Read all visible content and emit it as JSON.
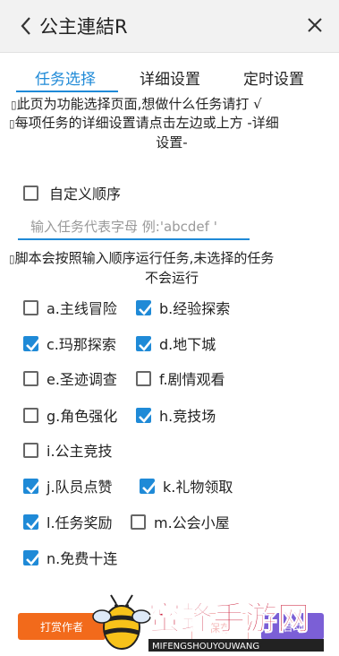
{
  "header": {
    "title": "公主連結R"
  },
  "tabs": [
    {
      "label": "任务选择",
      "active": true
    },
    {
      "label": "详细设置",
      "active": false
    },
    {
      "label": "定时设置",
      "active": false
    }
  ],
  "info": {
    "glyph": "▯",
    "line1": "此页为功能选择页面,想做什么任务请打 √",
    "line2a": "每项任务的详细设置请点击左边或上方 -详细",
    "line2b": "设置-",
    "line3a": "脚本会按照输入顺序运行任务,未选择的任务",
    "line3b": "不会运行"
  },
  "custom_order": {
    "label": "自定义顺序",
    "checked": false
  },
  "order_input": {
    "placeholder": "输入任务代表字母 例:'abcdef '",
    "value": ""
  },
  "tasks": [
    {
      "label": "a.主线冒险",
      "checked": false
    },
    {
      "label": "b.经验探索",
      "checked": true
    },
    {
      "label": "c.玛那探索",
      "checked": true
    },
    {
      "label": "d.地下城",
      "checked": true
    },
    {
      "label": "e.圣迹调查",
      "checked": false
    },
    {
      "label": "f.剧情观看",
      "checked": false
    },
    {
      "label": "g.角色强化",
      "checked": false
    },
    {
      "label": "h.竞技场",
      "checked": true
    },
    {
      "label": "i.公主竞技",
      "checked": false
    },
    {
      "label": "j.队员点赞",
      "checked": true
    },
    {
      "label": "k.礼物领取",
      "checked": true
    },
    {
      "label": "l.任务奖励",
      "checked": true
    },
    {
      "label": "m.公会小屋",
      "checked": false
    },
    {
      "label": "n.免费十连",
      "checked": true
    }
  ],
  "footer": {
    "reward_label": "打赏作者",
    "faint_label": "保存",
    "start_label": "启动"
  },
  "watermark": {
    "name": "蜜蜂手游网",
    "url": "MIFENGSHOUYOUWANG"
  },
  "colors": {
    "accent": "#1f8ad7",
    "reward": "#f26a1b",
    "start": "#7b5fd6",
    "watermark_red": "#c8102e"
  }
}
